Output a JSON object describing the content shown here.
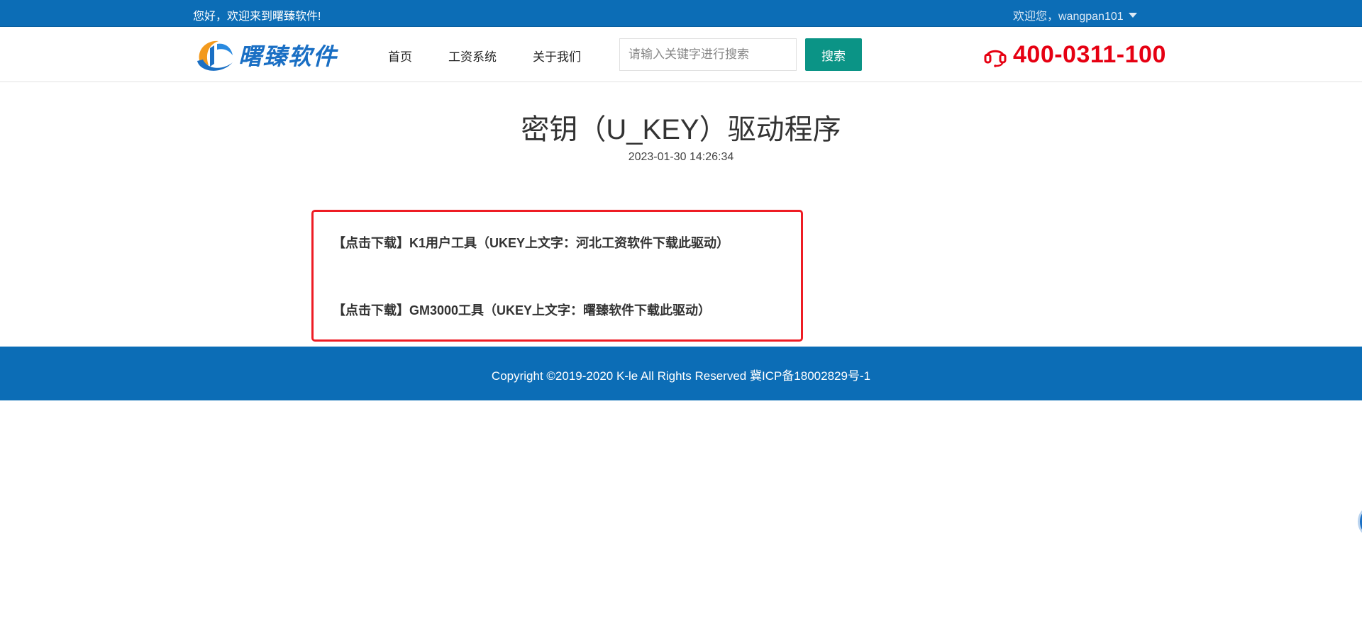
{
  "topbar": {
    "welcome": "您好，欢迎来到曙臻软件!",
    "user_label": "欢迎您，wangpan101"
  },
  "header": {
    "logo_text": "曙臻软件",
    "nav": [
      "首页",
      "工资系统",
      "关于我们"
    ],
    "search_placeholder": "请输入关键字进行搜索",
    "search_button": "搜索",
    "hotline": "400-0311-100"
  },
  "article": {
    "title": "密钥（U_KEY）驱动程序",
    "date": "2023-01-30 14:26:34",
    "links": [
      "【点击下载】K1用户工具（UKEY上文字：河北工资软件下载此驱动）",
      "【点击下载】GM3000工具（UKEY上文字：曙臻软件下载此驱动）"
    ]
  },
  "footer": {
    "copyright": "Copyright ©2019-2020 K-le All Rights Reserved  冀ICP备18002829号-1"
  },
  "colors": {
    "brand_blue": "#0c6db6",
    "search_button_teal": "#0b9486",
    "hotline_red": "#e60012",
    "highlight_box_red": "#ee1c24"
  },
  "icons": {
    "logo": "brand-swoosh-logo-icon",
    "user_menu": "caret-down-icon",
    "hotline": "headset-icon"
  }
}
